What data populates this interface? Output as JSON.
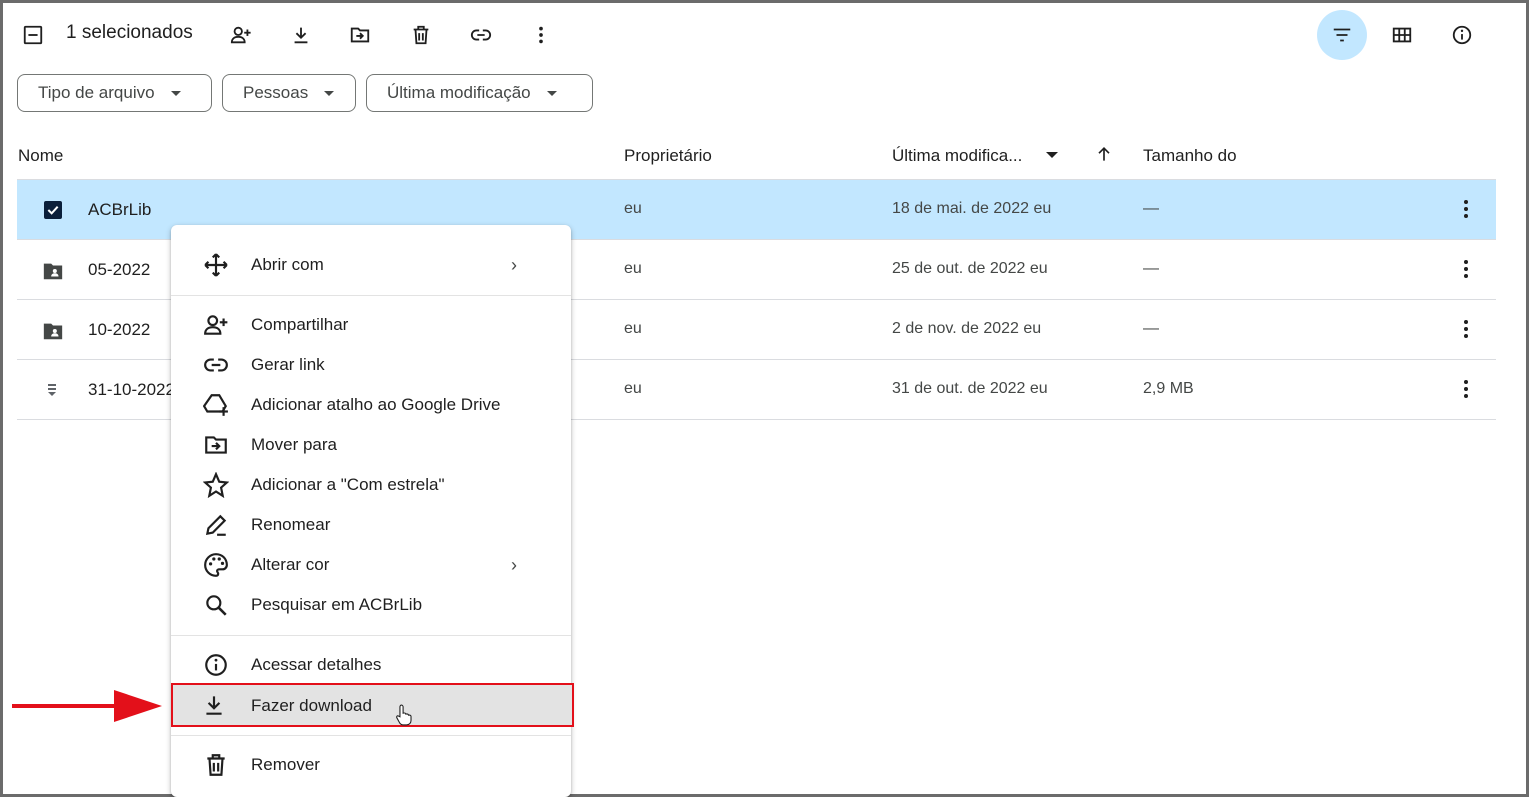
{
  "toolbar": {
    "selection_text": "1 selecionados",
    "icons": [
      "deselect-icon",
      "share-icon",
      "download-icon",
      "move-icon",
      "trash-icon",
      "link-icon",
      "more-vert-icon",
      "filter-icon",
      "grid-view-icon",
      "info-icon"
    ]
  },
  "filters": [
    {
      "label": "Tipo de arquivo"
    },
    {
      "label": "Pessoas"
    },
    {
      "label": "Última modificação"
    }
  ],
  "columns": {
    "name": "Nome",
    "owner": "Proprietário",
    "modified": "Última modifica...",
    "size": "Tamanho do"
  },
  "rows": [
    {
      "name": "ACBrLib",
      "owner": "eu",
      "modified": "18 de mai. de 2022",
      "modified_by": "eu",
      "size": "—",
      "selected": true
    },
    {
      "name": "05-2022",
      "owner": "eu",
      "modified": "25 de out. de 2022",
      "modified_by": "eu",
      "size": "—"
    },
    {
      "name": "10-2022",
      "owner": "eu",
      "modified": "2 de nov. de 2022",
      "modified_by": "eu",
      "size": "—"
    },
    {
      "name": "31-10-2022",
      "owner": "eu",
      "modified": "31 de out. de 2022",
      "modified_by": "eu",
      "size": "2,9 MB"
    }
  ],
  "context_menu": {
    "items": [
      {
        "label": "Abrir com",
        "icon": "open-with-icon",
        "submenu": true
      },
      {
        "label": "Compartilhar",
        "icon": "share-icon"
      },
      {
        "label": "Gerar link",
        "icon": "link-icon"
      },
      {
        "label": "Adicionar atalho ao Google Drive",
        "icon": "add-shortcut-icon"
      },
      {
        "label": "Mover para",
        "icon": "move-icon"
      },
      {
        "label": "Adicionar a \"Com estrela\"",
        "icon": "star-icon"
      },
      {
        "label": "Renomear",
        "icon": "rename-icon"
      },
      {
        "label": "Alterar cor",
        "icon": "palette-icon",
        "submenu": true
      },
      {
        "label": "Pesquisar em ACBrLib",
        "icon": "search-icon"
      },
      {
        "label": "Acessar detalhes",
        "icon": "info-icon"
      },
      {
        "label": "Fazer download",
        "icon": "download-icon",
        "highlighted": true
      },
      {
        "label": "Remover",
        "icon": "trash-icon"
      }
    ]
  },
  "colors": {
    "selected_row": "#c2e7ff",
    "highlight_border": "#e3101a",
    "filter_active": "#c2e7ff"
  }
}
